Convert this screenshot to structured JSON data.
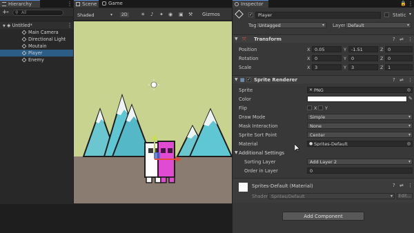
{
  "hierarchy": {
    "tab_label": "Hierarchy",
    "add_label": "+",
    "search_placeholder": "All",
    "scene_name": "Untitled*",
    "items": [
      "Main Camera",
      "Directional Light",
      "Moutain",
      "Player",
      "Enemy"
    ],
    "selected": "Player"
  },
  "scene": {
    "tabs": [
      "Scene",
      "Game"
    ],
    "shading_mode": "Shaded",
    "mode_2d": "2D",
    "gizmos_label": "Gizmos"
  },
  "inspector": {
    "tab_label": "Inspector",
    "object_name": "Player",
    "static_label": "Static",
    "tag_label": "Tag",
    "tag_value": "Untagged",
    "layer_label": "Layer",
    "layer_value": "Default",
    "transform": {
      "title": "Transform",
      "position_label": "Position",
      "rotation_label": "Rotation",
      "scale_label": "Scale",
      "position": {
        "x": "0.05",
        "y": "-1.51",
        "z": "0"
      },
      "rotation": {
        "x": "0",
        "y": "0",
        "z": "0"
      },
      "scale": {
        "x": "3",
        "y": "3",
        "z": "1"
      },
      "axis_x": "X",
      "axis_y": "Y",
      "axis_z": "Z"
    },
    "sprite_renderer": {
      "title": "Sprite Renderer",
      "sprite_label": "Sprite",
      "sprite_value": "PNG",
      "color_label": "Color",
      "color_value": "#ffffff",
      "flip_label": "Flip",
      "flip_x": "X",
      "flip_y": "Y",
      "draw_mode_label": "Draw Mode",
      "draw_mode_value": "Simple",
      "mask_label": "Mask Interaction",
      "mask_value": "None",
      "sort_point_label": "Sprite Sort Point",
      "sort_point_value": "Center",
      "material_label": "Material",
      "material_value": "Sprites-Default",
      "additional_label": "Additional Settings",
      "sorting_layer_label": "Sorting Layer",
      "sorting_layer_value": "Add Layer 2",
      "order_label": "Order in Layer",
      "order_value": "0"
    },
    "material": {
      "title": "Sprites-Default (Material)",
      "shader_label": "Shader",
      "shader_value": "Sprites/Default",
      "edit_label": "Edit..."
    },
    "add_component_label": "Add Component"
  },
  "colors": {
    "selection": "#2c5d87",
    "sky": "#c8d38f",
    "ground": "#8a7c70",
    "mountain": "#5fc6d3",
    "snow": "#e9eef0",
    "enemy": "#e14bd1"
  }
}
